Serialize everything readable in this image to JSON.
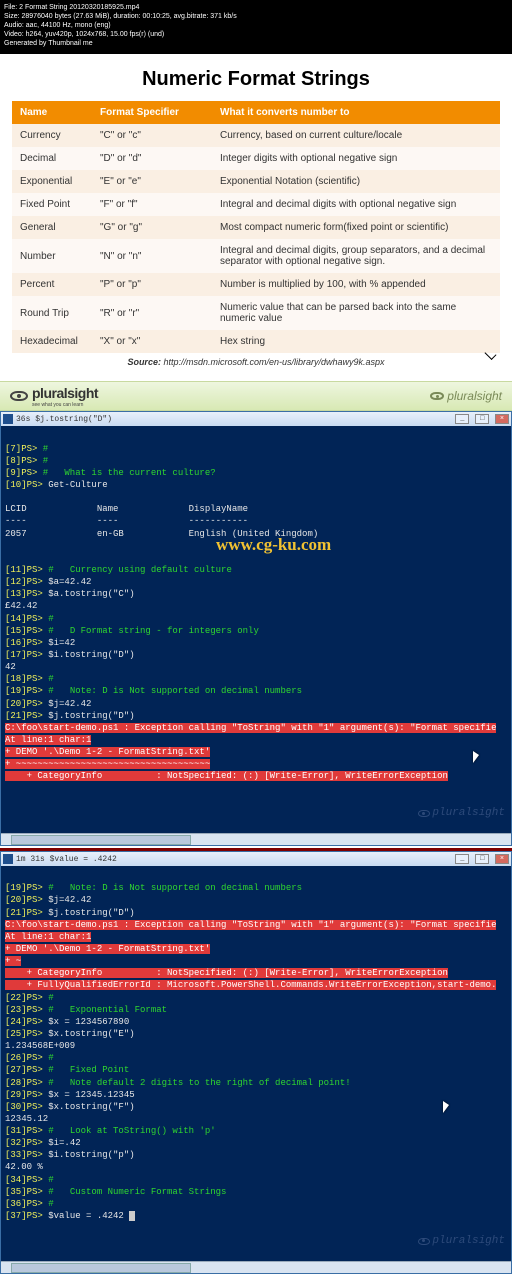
{
  "meta": {
    "l1": "File: 2 Format String 20120320185925.mp4",
    "l2": "Size: 28976040 bytes (27.63 MiB), duration: 00:10:25, avg.bitrate: 371 kb/s",
    "l3": "Audio: aac, 44100 Hz, mono (eng)",
    "l4": "Video: h264, yuv420p, 1024x768, 15.00 fps(r) (und)",
    "l5": "Generated by Thumbnail me"
  },
  "slide": {
    "title": "Numeric Format Strings",
    "headers": {
      "h1": "Name",
      "h2": "Format Specifier",
      "h3": "What it converts number to"
    },
    "rows": [
      {
        "c1": "Currency",
        "c2": "\"C\" or \"c\"",
        "c3": "Currency, based on current culture/locale"
      },
      {
        "c1": "Decimal",
        "c2": "\"D\" or \"d\"",
        "c3": "Integer digits with optional negative sign"
      },
      {
        "c1": "Exponential",
        "c2": "\"E\" or \"e\"",
        "c3": "Exponential Notation (scientific)"
      },
      {
        "c1": "Fixed Point",
        "c2": "\"F\" or \"f\"",
        "c3": "Integral and decimal digits with optional negative sign"
      },
      {
        "c1": "General",
        "c2": "\"G\" or \"g\"",
        "c3": "Most compact numeric form(fixed point or scientific)"
      },
      {
        "c1": "Number",
        "c2": "\"N\" or \"n\"",
        "c3": "Integral and decimal digits, group separators, and a decimal separator with optional negative sign."
      },
      {
        "c1": "Percent",
        "c2": "\"P\" or \"p\"",
        "c3": "Number is multiplied by 100, with % appended"
      },
      {
        "c1": "Round Trip",
        "c2": "\"R\" or \"r\"",
        "c3": "Numeric value that can be parsed back into the same numeric value"
      },
      {
        "c1": "Hexadecimal",
        "c2": "\"X\" or \"x\"",
        "c3": "Hex string"
      }
    ],
    "source_label": "Source:",
    "source_url": "http://msdn.microsoft.com/en-us/library/dwhawy9k.aspx"
  },
  "psbar": {
    "brand": "pluralsight",
    "tag": "see what you can learn",
    "right": "pluralsight"
  },
  "win1": {
    "title": "36s  $j.tostring(\"D\")",
    "min": "_",
    "max": "□",
    "close": "×",
    "lines": {
      "p7": "[7]PS>",
      "p7a": " #",
      "p8": "[8]PS>",
      "p8a": " #",
      "p9": "[9]PS>",
      "p9a": " #   What is the current culture?",
      "p10": "[10]PS>",
      "p10a": " Get-Culture",
      "hdr": "LCID             Name             DisplayName",
      "dsh": "----             ----             -----------",
      "row": "2057             en-GB            English (United Kingdom)",
      "p11": "[11]PS>",
      "p11a": " #   Currency using default culture",
      "p12": "[12]PS>",
      "p12a": " $a=42.42",
      "p13": "[13]PS>",
      "p13a": " $a.tostring(\"C\")",
      "out1": "£42.42",
      "p14": "[14]PS>",
      "p14a": " #",
      "p15": "[15]PS>",
      "p15a": " #   D Format string - for integers only",
      "p16": "[16]PS>",
      "p16a": " $i=42",
      "p17": "[17]PS>",
      "p17a": " $i.tostring(\"D\")",
      "out2": "42",
      "p18": "[18]PS>",
      "p18a": " #",
      "p19": "[19]PS>",
      "p19a": " #   Note: D is Not supported on decimal numbers",
      "p20": "[20]PS>",
      "p20a": " $j=42.42",
      "p21": "[21]PS>",
      "p21a": " $j.tostring(\"D\")",
      "err1": "C:\\foo\\start-demo.ps1 : Exception calling \"ToString\" with \"1\" argument(s): \"Format specifie",
      "err2": "At line:1 char:1",
      "err3": "+ DEMO '.\\Demo 1-2 - FormatString.txt'",
      "err4": "+ ~~~~~~~~~~~~~~~~~~~~~~~~~~~~~~~~~~~~",
      "err5": "    + CategoryInfo          : NotSpecified: (:) [Write-Error], WriteErrorException",
      "watermark": "www.cg-ku.com",
      "footer": "pluralsight"
    }
  },
  "win2": {
    "title": "1m 31s  $value = .4242",
    "min": "_",
    "max": "□",
    "close": "×",
    "lines": {
      "p19": "[19]PS>",
      "p19a": " #   Note: D is Not supported on decimal numbers",
      "p20": "[20]PS>",
      "p20a": " $j=42.42",
      "p21": "[21]PS>",
      "p21a": " $j.tostring(\"D\")",
      "err1": "C:\\foo\\start-demo.ps1 : Exception calling \"ToString\" with \"1\" argument(s): \"Format specifie",
      "err2": "At line:1 char:1",
      "err3": "+ DEMO '.\\Demo 1-2 - FormatString.txt'",
      "err4": "+ ~",
      "err5": "    + CategoryInfo          : NotSpecified: (:) [Write-Error], WriteErrorException",
      "err6": "    + FullyQualifiedErrorId : Microsoft.PowerShell.Commands.WriteErrorException,start-demo.",
      "p22": "[22]PS>",
      "p22a": " #",
      "p23": "[23]PS>",
      "p23a": " #   Exponential Format",
      "p24": "[24]PS>",
      "p24a": " $x = 1234567890",
      "p25": "[25]PS>",
      "p25a": " $x.tostring(\"E\")",
      "out1": "1.234568E+009",
      "p26": "[26]PS>",
      "p26a": " #",
      "p27": "[27]PS>",
      "p27a": " #   Fixed Point",
      "p28": "[28]PS>",
      "p28a": " #   Note default 2 digits to the right of decimal point!",
      "p29": "[29]PS>",
      "p29a": " $x = 12345.12345",
      "p30": "[30]PS>",
      "p30a": " $x.tostring(\"F\")",
      "out2": "12345.12",
      "p31": "[31]PS>",
      "p31a": " #   Look at ToString() with 'p'",
      "p32": "[32]PS>",
      "p32a": " $i=.42",
      "p33": "[33]PS>",
      "p33a": " $i.tostring(\"p\")",
      "out3": "42.00 %",
      "p34": "[34]PS>",
      "p34a": " #",
      "p35": "[35]PS>",
      "p35a": " #   Custom Numeric Format Strings",
      "p36": "[36]PS>",
      "p36a": " #",
      "p37": "[37]PS>",
      "p37a": " $value = .4242 ",
      "footer": "pluralsight"
    }
  }
}
